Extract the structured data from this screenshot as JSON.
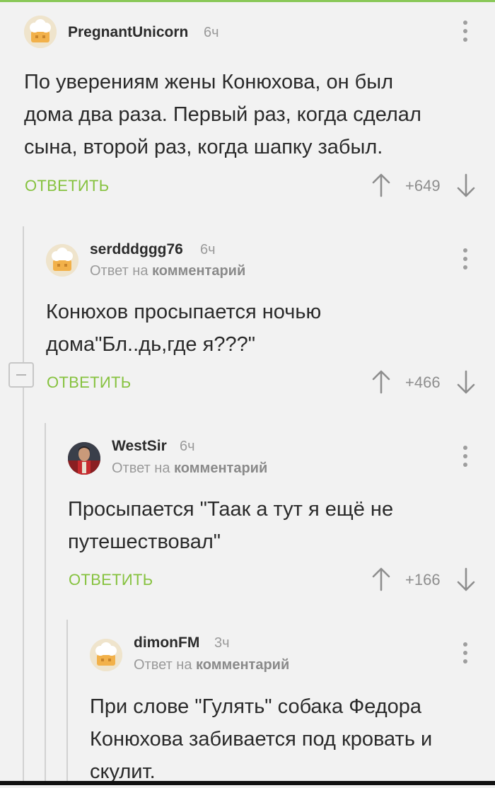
{
  "comments": [
    {
      "username": "PregnantUnicorn",
      "time": "6ч",
      "reply_to": "",
      "text_lines": [
        "По уверениям жены Конюхова, он был",
        "дома два раза. Первый раз, когда сделал",
        "сына, второй раз, когда шапку забыл."
      ],
      "reply_label": "ОТВЕТИТЬ",
      "score": "+649"
    },
    {
      "username": "serdddggg76",
      "time": "6ч",
      "reply_prefix": "Ответ на",
      "reply_target": "комментарий",
      "text_lines": [
        "Конюхов просыпается ночью",
        "дома\"Бл..дь,где я???\""
      ],
      "reply_label": "ОТВЕТИТЬ",
      "score": "+466"
    },
    {
      "username": "WestSir",
      "time": "6ч",
      "reply_prefix": "Ответ на",
      "reply_target": "комментарий",
      "text_lines": [
        "Просыпается \"Таак а тут я ещё не",
        "путешествовал\""
      ],
      "reply_label": "ОТВЕТИТЬ",
      "score": "+166"
    },
    {
      "username": "dimonFM",
      "time": "3ч",
      "reply_prefix": "Ответ на",
      "reply_target": "комментарий",
      "text_lines": [
        "При слове \"Гулять\" собака Федора",
        "Конюхова забивается под кровать и",
        "скулит."
      ]
    }
  ],
  "colors": {
    "accent_green": "#86c23f",
    "top_line": "#8ac858",
    "background": "#f2f2f2"
  },
  "icons": {
    "more": "vertical-dots-icon",
    "upvote": "arrow-up-icon",
    "downvote": "arrow-down-icon",
    "collapse": "minus-icon",
    "avatar_default": "chef-hat-avatar-icon"
  }
}
